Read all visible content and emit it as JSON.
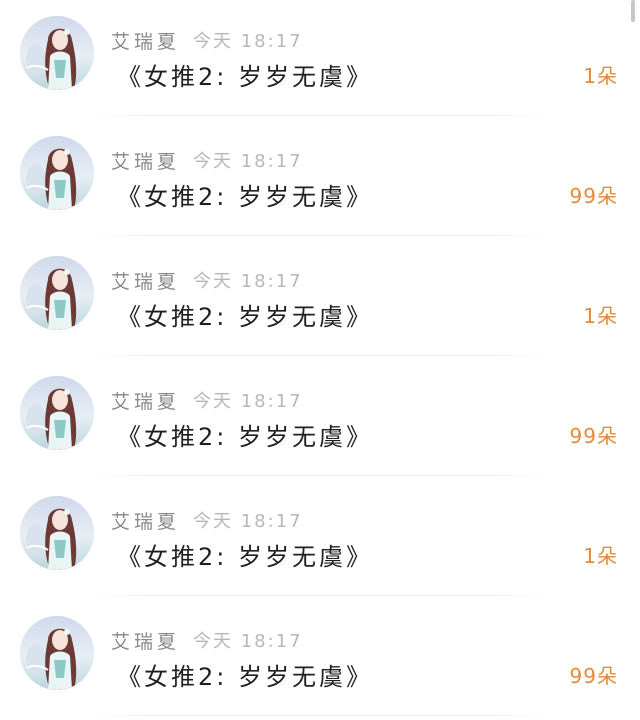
{
  "rows": [
    {
      "name": "艾瑞夏",
      "time": "今天 18:17",
      "title": "《女推2: 岁岁无虞》",
      "gift": "1朵"
    },
    {
      "name": "艾瑞夏",
      "time": "今天 18:17",
      "title": "《女推2: 岁岁无虞》",
      "gift": "99朵"
    },
    {
      "name": "艾瑞夏",
      "time": "今天 18:17",
      "title": "《女推2: 岁岁无虞》",
      "gift": "1朵"
    },
    {
      "name": "艾瑞夏",
      "time": "今天 18:17",
      "title": "《女推2: 岁岁无虞》",
      "gift": "99朵"
    },
    {
      "name": "艾瑞夏",
      "time": "今天 18:17",
      "title": "《女推2: 岁岁无虞》",
      "gift": "1朵"
    },
    {
      "name": "艾瑞夏",
      "time": "今天 18:17",
      "title": "《女推2: 岁岁无虞》",
      "gift": "99朵"
    }
  ],
  "colors": {
    "gift": "#e3893a",
    "name": "#8a8a8a",
    "time": "#b7b7b7",
    "title": "#1f1f1f"
  },
  "icons": {
    "avatar": "character-portrait-avatar"
  }
}
